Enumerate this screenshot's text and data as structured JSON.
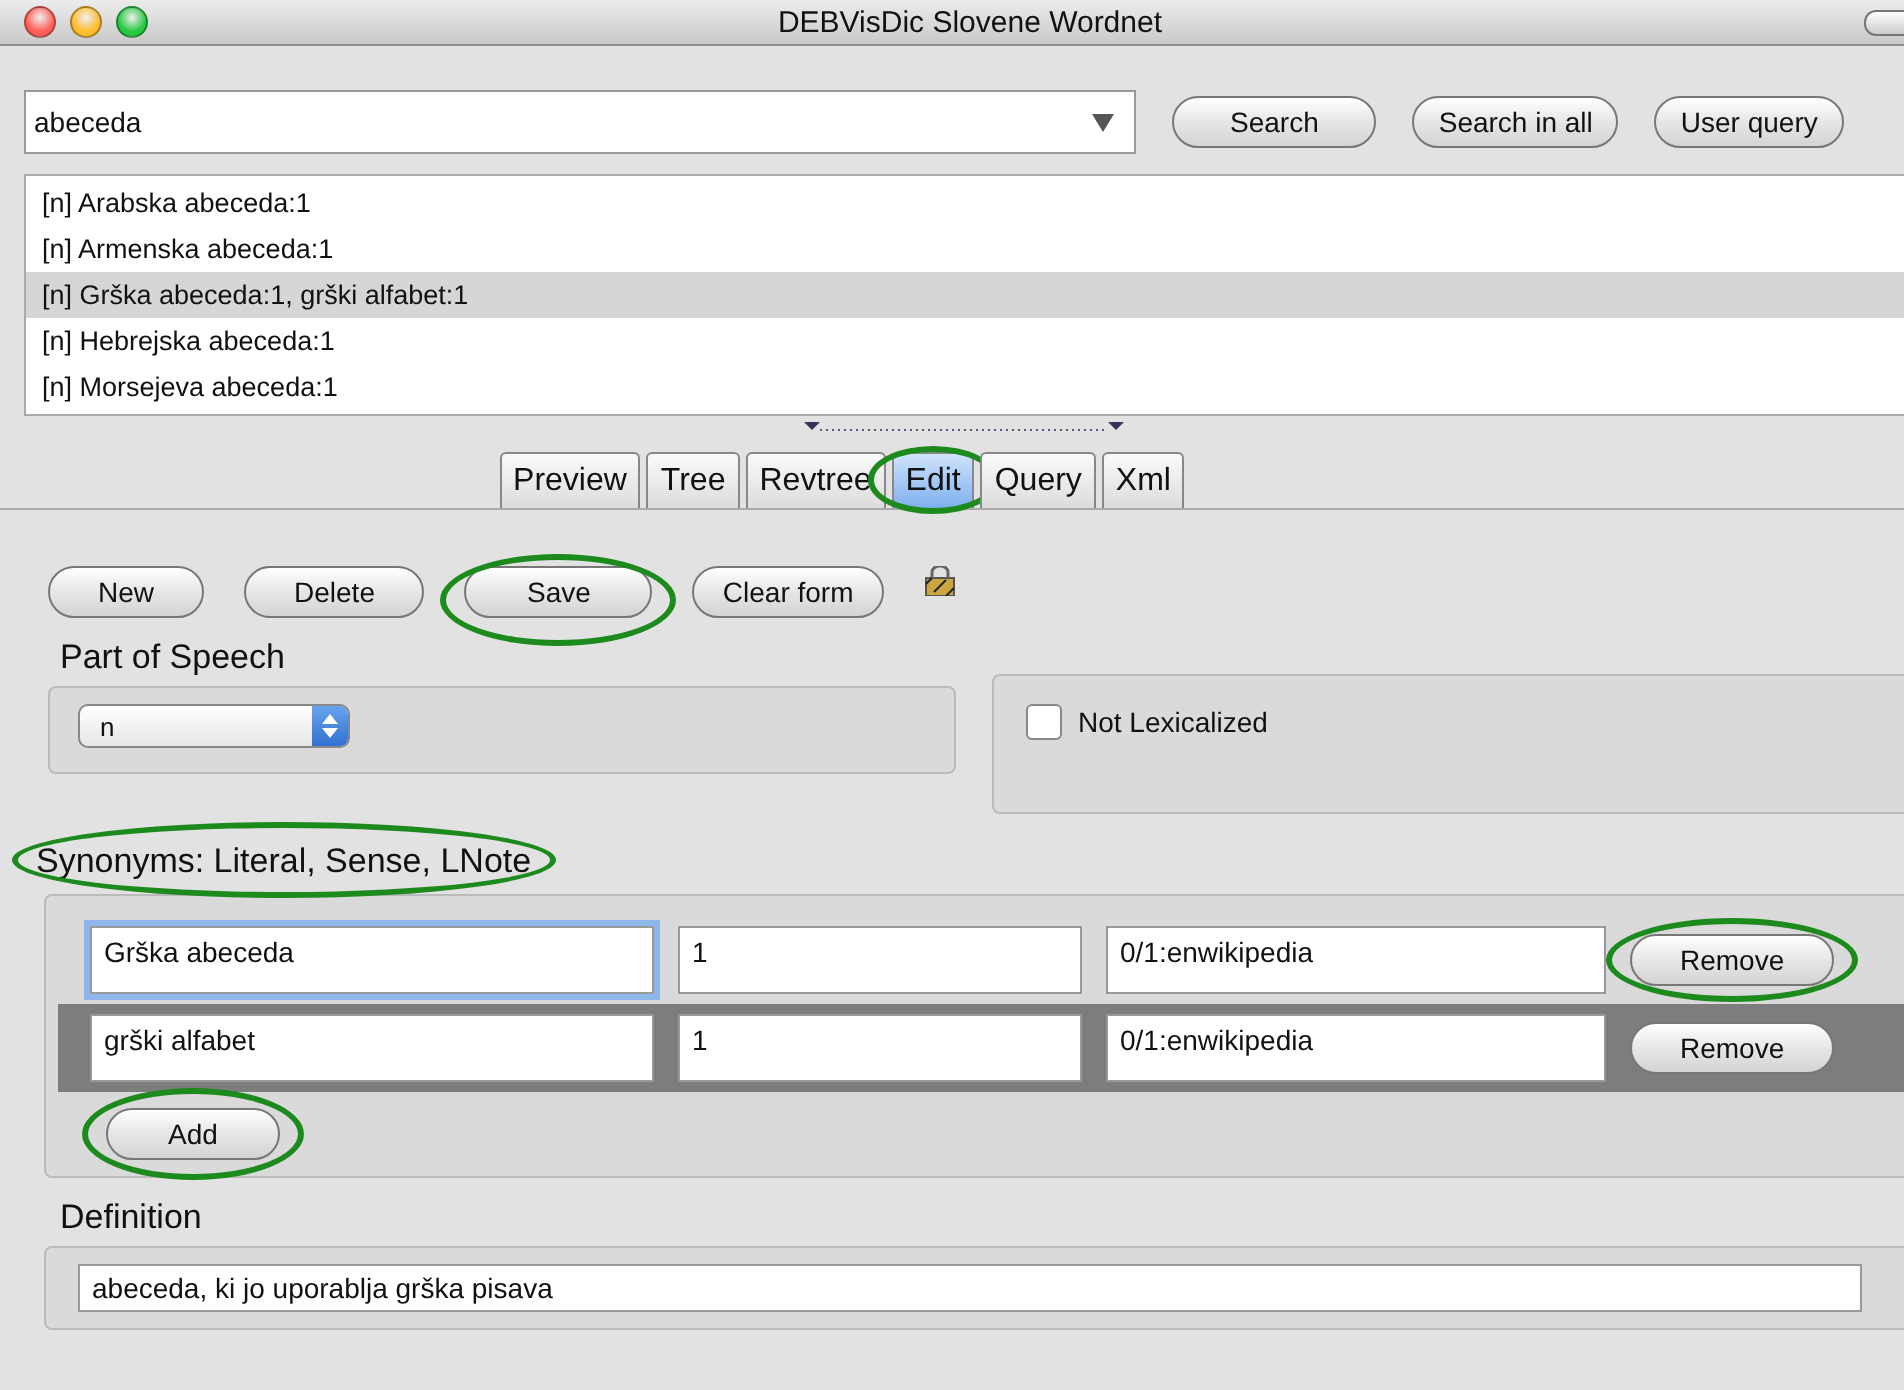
{
  "window": {
    "title": "DEBVisDic Slovene Wordnet"
  },
  "search": {
    "value": "abeceda"
  },
  "search_buttons": [
    {
      "label": "Search"
    },
    {
      "label": "Search in all"
    },
    {
      "label": "User query"
    }
  ],
  "results": [
    {
      "text": "[n] Arabska abeceda:1",
      "selected": false
    },
    {
      "text": "[n] Armenska abeceda:1",
      "selected": false
    },
    {
      "text": "[n] Grška abeceda:1, grški alfabet:1",
      "selected": true
    },
    {
      "text": "[n] Hebrejska abeceda:1",
      "selected": false
    },
    {
      "text": "[n] Morsejeva abeceda:1",
      "selected": false
    }
  ],
  "tabs": [
    {
      "label": "Preview",
      "selected": false,
      "highlighted": false
    },
    {
      "label": "Tree",
      "selected": false,
      "highlighted": false
    },
    {
      "label": "Revtree",
      "selected": false,
      "highlighted": false
    },
    {
      "label": "Edit",
      "selected": true,
      "highlighted": true
    },
    {
      "label": "Query",
      "selected": false,
      "highlighted": false
    },
    {
      "label": "Xml",
      "selected": false,
      "highlighted": false
    }
  ],
  "actions": [
    {
      "label": "New",
      "highlighted": false
    },
    {
      "label": "Delete",
      "highlighted": false
    },
    {
      "label": "Save",
      "highlighted": true
    },
    {
      "label": "Clear form",
      "highlighted": false
    }
  ],
  "part_of_speech": {
    "label": "Part of Speech",
    "value": "n"
  },
  "not_lexicalized": {
    "label": "Not Lexicalized",
    "checked": false
  },
  "synonyms": {
    "label": "Synonyms: Literal, Sense, LNote",
    "highlighted": true,
    "rows": [
      {
        "literal": "Grška abeceda",
        "sense": "1",
        "lnote": "0/1:enwikipedia",
        "selected": false,
        "focused": true,
        "remove": {
          "label": "Remove",
          "highlighted": true
        }
      },
      {
        "literal": "grški alfabet",
        "sense": "1",
        "lnote": "0/1:enwikipedia",
        "selected": true,
        "focused": false,
        "remove": {
          "label": "Remove",
          "highlighted": false
        }
      }
    ],
    "add": {
      "label": "Add",
      "highlighted": true
    }
  },
  "definition": {
    "label": "Definition",
    "value": "abeceda, ki jo uporablja grška pisava"
  }
}
